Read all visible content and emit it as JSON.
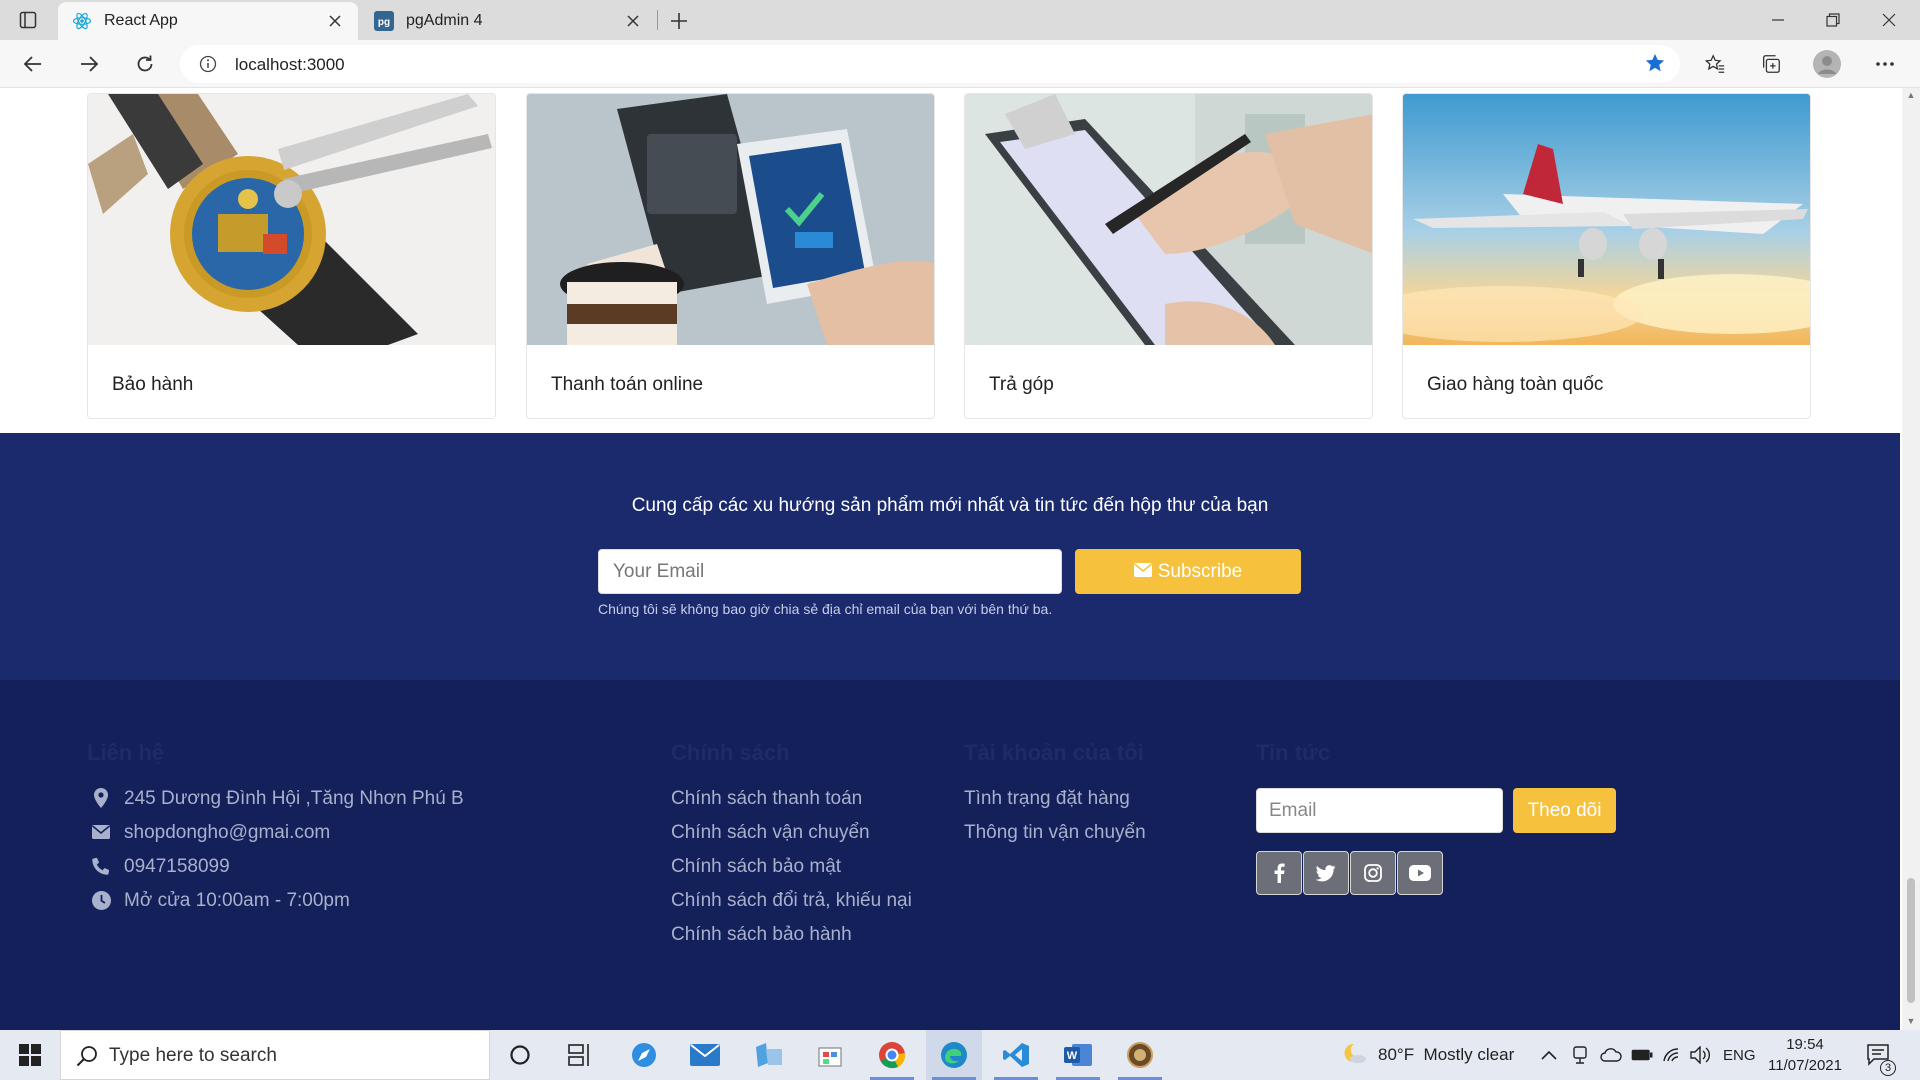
{
  "browser": {
    "tabs": [
      {
        "title": "React App",
        "active": true,
        "favicon": "react-icon"
      },
      {
        "title": "pgAdmin 4",
        "active": false,
        "favicon": "pgadmin-icon"
      }
    ],
    "url": "localhost:3000"
  },
  "services": [
    {
      "title": "Bảo hành",
      "image": "watch-repair"
    },
    {
      "title": "Thanh toán online",
      "image": "mobile-payment"
    },
    {
      "title": "Trả góp",
      "image": "clipboard-signing"
    },
    {
      "title": "Giao hàng toàn quốc",
      "image": "airplane"
    }
  ],
  "newsletter": {
    "title": "Cung cấp các xu hướng sản phẩm mới nhất và tin tức đến hộp thư của bạn",
    "email_placeholder": "Your Email",
    "subscribe_label": "Subscribe",
    "note": "Chúng tôi sẽ không bao giờ chia sẻ địa chỉ email của bạn với bên thứ ba."
  },
  "footer": {
    "contact": {
      "heading": "Liên hệ",
      "address": "245 Dương Đình Hội ,Tăng Nhơn Phú B",
      "email": "shopdongho@gmai.com",
      "phone": "0947158099",
      "hours": "Mở cửa 10:00am - 7:00pm"
    },
    "policy": {
      "heading": "Chính sách",
      "links": [
        "Chính sách thanh toán",
        "Chính sách vận chuyển",
        "Chính sách bảo mật",
        "Chính sách đổi trả, khiếu nại",
        "Chính sách bảo hành"
      ]
    },
    "account": {
      "heading": "Tài khoản của tôi",
      "links": [
        "Tình trạng đặt hàng",
        "Thông tin vận chuyển"
      ]
    },
    "news": {
      "heading": "Tin tức",
      "email_placeholder": "Email",
      "follow_label": "Theo dõi",
      "socials": [
        "facebook-icon",
        "twitter-icon",
        "instagram-icon",
        "youtube-icon"
      ]
    }
  },
  "taskbar": {
    "search_placeholder": "Type here to search",
    "weather": "80°F  Mostly clear",
    "language": "ENG",
    "time": "19:54",
    "date": "11/07/2021",
    "notification_count": "3"
  },
  "colors": {
    "newsletter_bg": "#1a2a6c",
    "footer_bg": "#13205a",
    "accent": "#f6c23e"
  }
}
